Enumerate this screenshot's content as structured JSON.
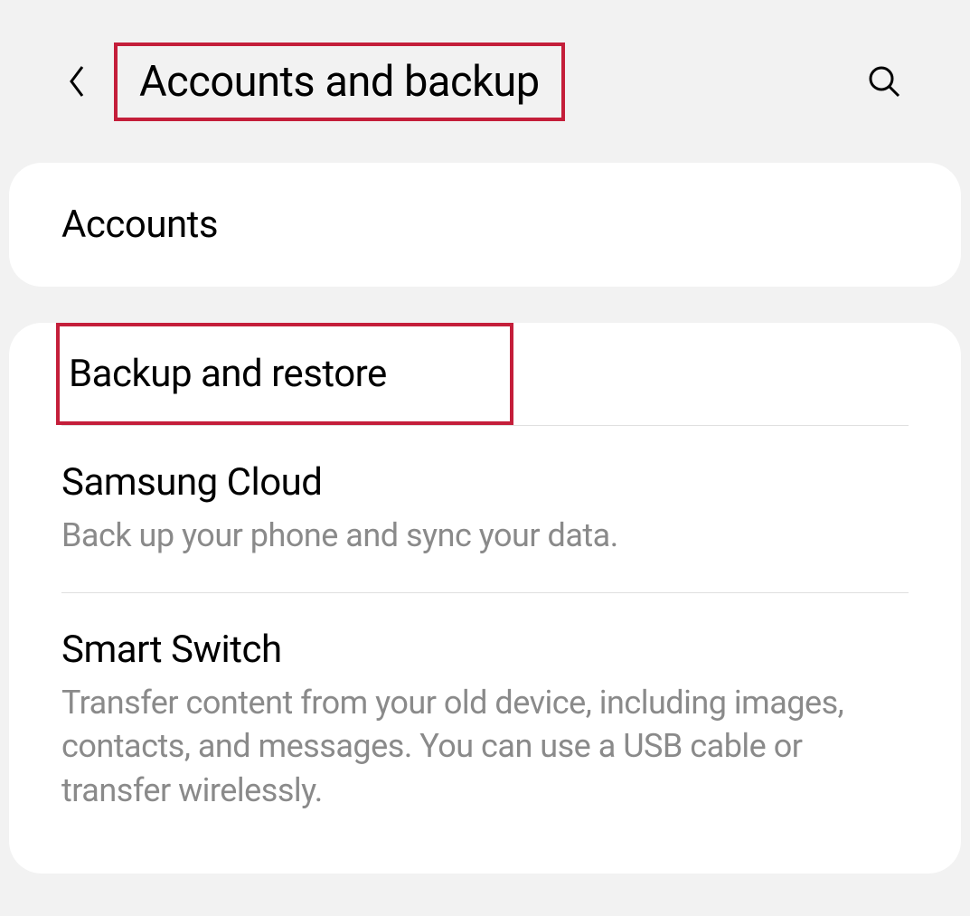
{
  "header": {
    "title": "Accounts and backup"
  },
  "sections": {
    "accounts": {
      "label": "Accounts"
    },
    "backup_restore": {
      "label": "Backup and restore"
    },
    "samsung_cloud": {
      "title": "Samsung Cloud",
      "subtitle": "Back up your phone and sync your data."
    },
    "smart_switch": {
      "title": "Smart Switch",
      "subtitle": "Transfer content from your old device, including images, contacts, and messages. You can use a USB cable or transfer wirelessly."
    }
  }
}
